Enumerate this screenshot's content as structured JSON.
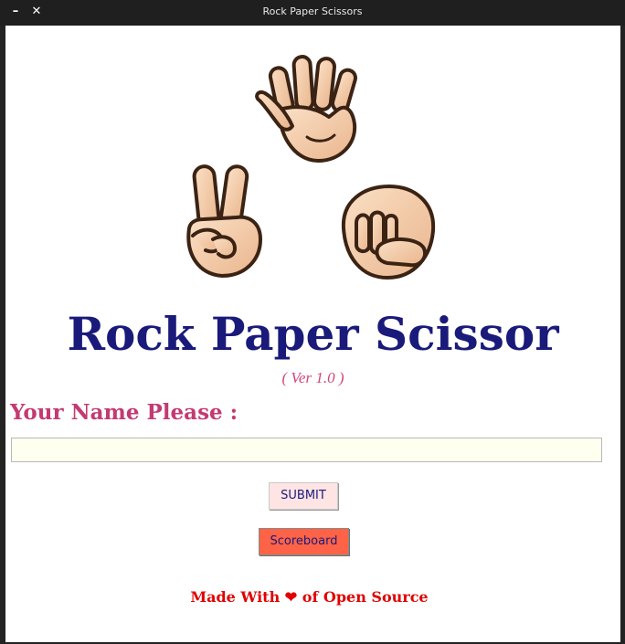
{
  "window": {
    "title": "Rock Paper Scissors",
    "minimize_icon": "minimize-icon",
    "close_icon": "close-icon"
  },
  "app": {
    "title": "Rock Paper Scissor",
    "version": "( Ver 1.0 )"
  },
  "form": {
    "name_label": "Your Name Please :",
    "name_value": "",
    "name_placeholder": ""
  },
  "buttons": {
    "submit_label": "SUBMIT",
    "scoreboard_label": "Scoreboard"
  },
  "footer": {
    "prefix": "Made With",
    "heart": "❤",
    "suffix": "of Open Source"
  },
  "images": {
    "paper": "paper-hand-icon",
    "scissors": "scissors-hand-icon",
    "rock": "rock-fist-icon"
  },
  "colors": {
    "title": "#1a1a7a",
    "version": "#d4457a",
    "label": "#c43a72",
    "input_bg": "#ffffef",
    "submit_bg": "#ffe4e4",
    "scoreboard_bg": "#ff6347",
    "footer": "#e00000",
    "skin": "#f3caa6",
    "outline": "#3b2314"
  }
}
